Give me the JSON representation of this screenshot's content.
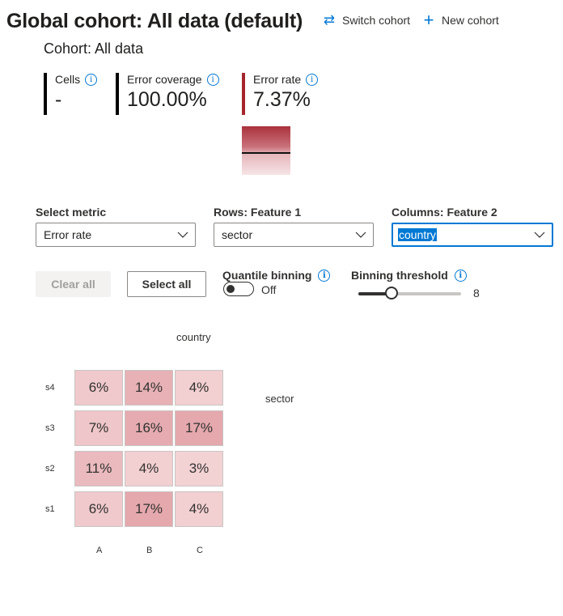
{
  "header": {
    "title": "Global cohort: All data (default)",
    "switch_cohort": "Switch cohort",
    "new_cohort": "New cohort"
  },
  "cohort": {
    "name": "Cohort: All data"
  },
  "metrics": {
    "cells": {
      "label": "Cells",
      "value": "-"
    },
    "error_coverage": {
      "label": "Error coverage",
      "value": "100.00%"
    },
    "error_rate": {
      "label": "Error rate",
      "value": "7.37%",
      "fraction": 0.0737
    }
  },
  "controls": {
    "select_metric": {
      "label": "Select metric",
      "value": "Error rate"
    },
    "rows": {
      "label": "Rows: Feature 1",
      "value": "sector"
    },
    "columns": {
      "label": "Columns: Feature 2",
      "value": "country"
    },
    "clear_all": "Clear all",
    "select_all": "Select all",
    "quantile_binning": {
      "label": "Quantile binning",
      "state": "Off"
    },
    "binning_threshold": {
      "label": "Binning threshold",
      "value": "8",
      "min": 1,
      "max": 20
    }
  },
  "heatmap": {
    "column_feature": "country",
    "row_feature": "sector",
    "columns": [
      "A",
      "B",
      "C"
    ],
    "rows": [
      {
        "name": "s4",
        "values": [
          "6%",
          "14%",
          "4%"
        ]
      },
      {
        "name": "s3",
        "values": [
          "7%",
          "16%",
          "17%"
        ]
      },
      {
        "name": "s2",
        "values": [
          "11%",
          "4%",
          "3%"
        ]
      },
      {
        "name": "s1",
        "values": [
          "6%",
          "17%",
          "4%"
        ]
      }
    ]
  },
  "colors": {
    "accent": "#0078d4",
    "error_bar": "#a4262c",
    "cell_low": "#f3d2d4",
    "cell_high": "#e4a8ad"
  }
}
